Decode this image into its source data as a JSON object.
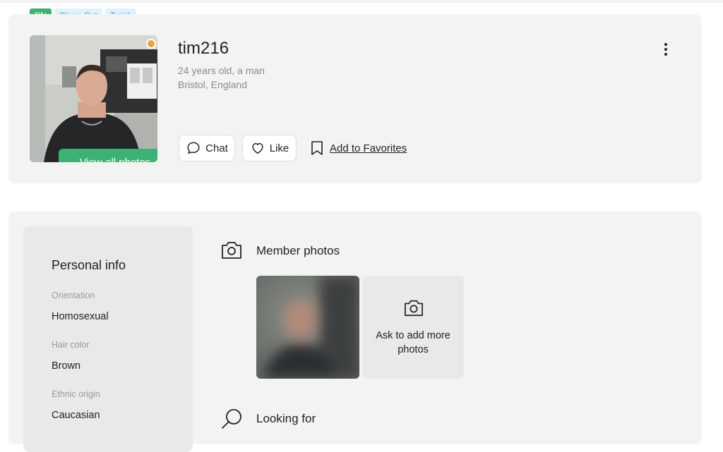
{
  "tags": [
    "PN",
    "Clean-Cut",
    "Twink"
  ],
  "profile": {
    "username": "tim216",
    "age_gender": "24 years old, a man",
    "location": "Bristol, England",
    "view_photos_label": "View all photos",
    "online_status_color": "#e8a33b"
  },
  "actions": {
    "chat_label": "Chat",
    "like_label": "Like",
    "favorites_label": "Add to Favorites"
  },
  "personal_info": {
    "title": "Personal info",
    "fields": [
      {
        "label": "Orientation",
        "value": "Homosexual"
      },
      {
        "label": "Hair color",
        "value": "Brown"
      },
      {
        "label": "Ethnic origin",
        "value": "Caucasian"
      }
    ]
  },
  "member_photos": {
    "title": "Member photos",
    "ask_more_label": "Ask to add more photos"
  },
  "looking_for": {
    "title": "Looking for"
  },
  "colors": {
    "accent_green": "#3bb273",
    "tag_blue_bg": "#dff2fb",
    "tag_blue_text": "#3c9fd2",
    "card_bg": "#f3f3f3"
  }
}
